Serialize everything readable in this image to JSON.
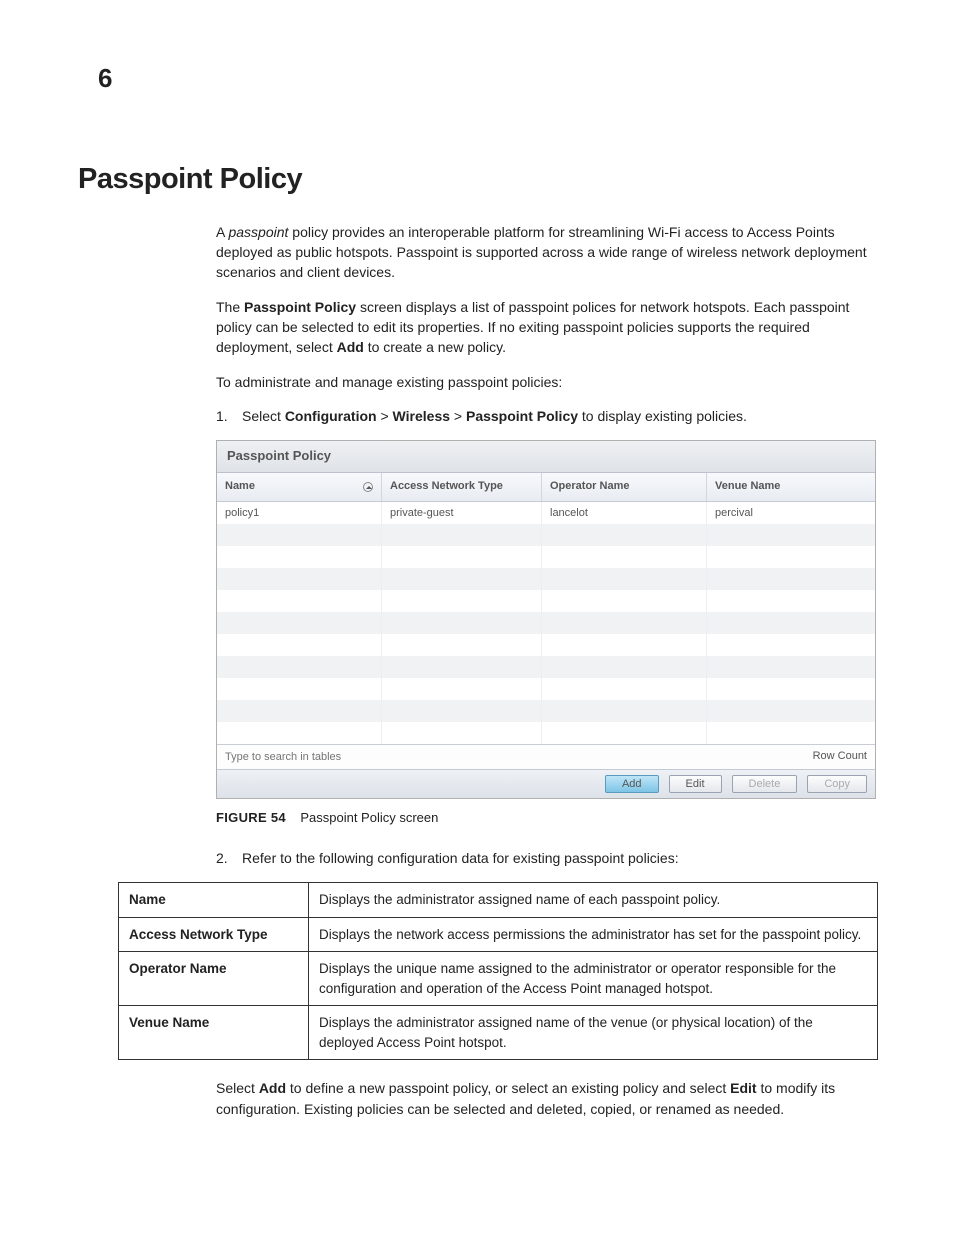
{
  "chapter_number": "6",
  "heading": "Passpoint Policy",
  "p1_pre": "A ",
  "p1_em": "passpoint",
  "p1_post": " policy provides an interoperable platform for streamlining Wi-Fi access to Access Points deployed as public hotspots. Passpoint is supported across a wide range of wireless network deployment scenarios and client devices.",
  "p2_a": "The ",
  "p2_b1": "Passpoint Policy",
  "p2_c": " screen displays a list of passpoint polices for network hotspots. Each passpoint policy can be selected to edit its properties. If no exiting passpoint policies supports the required deployment, select ",
  "p2_b2": "Add",
  "p2_d": " to create a new policy.",
  "p3": "To administrate and manage existing passpoint policies:",
  "step1_a": "Select ",
  "step1_b1": "Configuration",
  "step1_sep": " > ",
  "step1_b2": "Wireless",
  "step1_b3": "Passpoint Policy",
  "step1_c": " to display existing policies.",
  "ss": {
    "title": "Passpoint Policy",
    "headers": [
      "Name",
      "Access Network Type",
      "Operator Name",
      "Venue Name"
    ],
    "rows": [
      [
        "policy1",
        "private-guest",
        "lancelot",
        "percival"
      ],
      [
        "",
        "",
        "",
        ""
      ],
      [
        "",
        "",
        "",
        ""
      ],
      [
        "",
        "",
        "",
        ""
      ],
      [
        "",
        "",
        "",
        ""
      ],
      [
        "",
        "",
        "",
        ""
      ],
      [
        "",
        "",
        "",
        ""
      ],
      [
        "",
        "",
        "",
        ""
      ],
      [
        "",
        "",
        "",
        ""
      ],
      [
        "",
        "",
        "",
        ""
      ],
      [
        "",
        "",
        "",
        ""
      ]
    ],
    "search_placeholder": "Type to search in tables",
    "row_count_label": "Row Count",
    "buttons": {
      "add": "Add",
      "edit": "Edit",
      "delete": "Delete",
      "copy": "Copy"
    }
  },
  "figure_label": "FIGURE 54",
  "figure_caption": "Passpoint Policy screen",
  "step2": "Refer to the following configuration data for existing passpoint policies:",
  "fields": [
    {
      "name": "Name",
      "desc": "Displays the administrator assigned name of each passpoint policy."
    },
    {
      "name": "Access Network Type",
      "desc": "Displays the network access permissions the administrator has set for the passpoint policy."
    },
    {
      "name": "Operator Name",
      "desc": "Displays the unique name assigned to the administrator or operator responsible for the configuration and operation of the Access Point managed hotspot."
    },
    {
      "name": "Venue Name",
      "desc": "Displays the administrator assigned name of the venue (or physical location) of the deployed Access Point hotspot."
    }
  ],
  "p_last_a": "Select ",
  "p_last_b1": "Add",
  "p_last_c": " to define a new passpoint policy, or select an existing policy and select ",
  "p_last_b2": "Edit",
  "p_last_d": " to modify its configuration. Existing policies can be selected and deleted, copied, or renamed as needed."
}
